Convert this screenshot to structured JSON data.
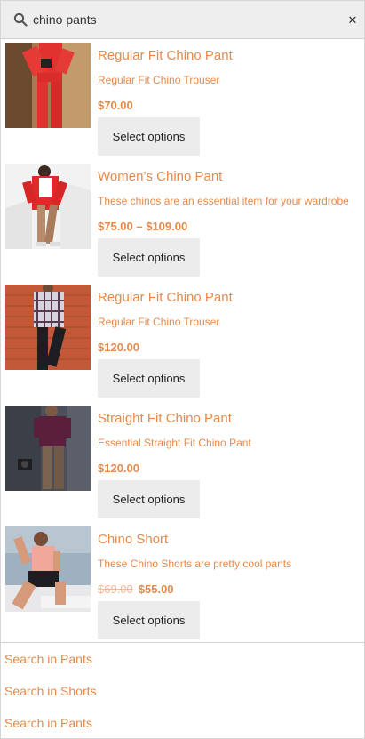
{
  "search": {
    "value": "chino pants",
    "placeholder": "Search…"
  },
  "products": [
    {
      "title": "Regular Fit Chino Pant",
      "description": "Regular Fit Chino Trouser",
      "price": "$70.00",
      "old_price": "",
      "button": "Select options",
      "image": "model-red-suit"
    },
    {
      "title": "Women’s Chino Pant",
      "description": "These chinos are an essential item for your wardrobe",
      "price": "$75.00 – $109.00",
      "old_price": "",
      "button": "Select options",
      "image": "model-red-cardigan"
    },
    {
      "title": "Regular Fit Chino Pant",
      "description": "Regular Fit Chino Trouser",
      "price": "$120.00",
      "old_price": "",
      "button": "Select options",
      "image": "model-plaid-shirt"
    },
    {
      "title": "Straight Fit Chino Pant",
      "description": "Essential Straight Fit Chino Pant",
      "price": "$120.00",
      "old_price": "",
      "button": "Select options",
      "image": "model-maroon-tee"
    },
    {
      "title": "Chino Short",
      "description": "These Chino Shorts are pretty cool pants",
      "price": "$55.00",
      "old_price": "$69.00",
      "button": "Select options",
      "image": "model-pink-tank"
    }
  ],
  "categories": [
    {
      "label": "Search in Pants"
    },
    {
      "label": "Search in Shorts"
    },
    {
      "label": "Search in Pants"
    }
  ],
  "colors": {
    "accent": "#e58a4b",
    "button_bg": "#ececec",
    "search_bg": "#eeeeee"
  },
  "icons": {
    "search": "search-icon",
    "close": "close-icon"
  }
}
